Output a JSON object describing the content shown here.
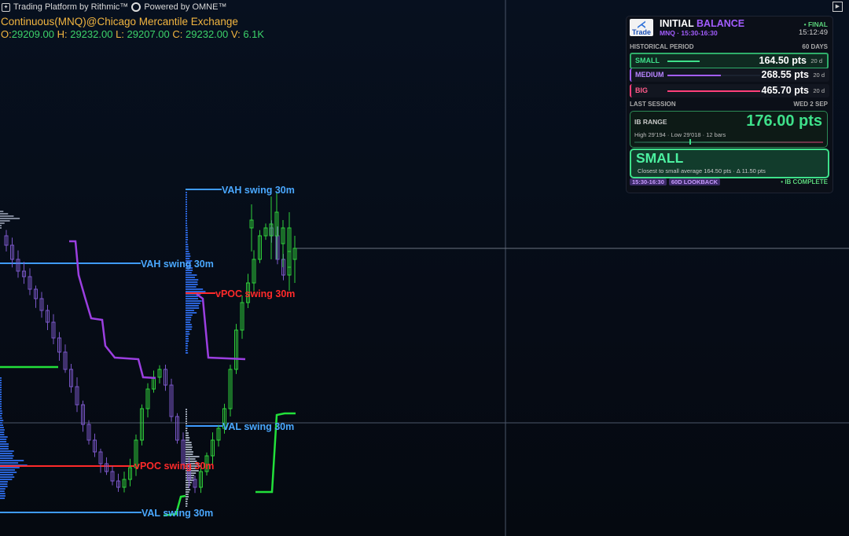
{
  "header": {
    "platform_text": "Trading Platform by Rithmic™",
    "powered_text": "Powered by OMNE™",
    "instrument": "Continuous(MNQ)@Chicago Mercantile Exchange",
    "ohlc": {
      "o_label": "O:",
      "o": "29209.00",
      "h_label": "H:",
      "h": "29232.00",
      "l_label": "L:",
      "l": "29207.00",
      "c_label": "C:",
      "c": "29232.00",
      "v_label": "V:",
      "v": "6.1K"
    }
  },
  "levels": {
    "vah_swing": "VAH swing 30m",
    "val_swing": "VAL swing 30m",
    "vpoc_swing": "vPOC swing 30m"
  },
  "colors": {
    "bull": "#2fcf3a",
    "bear": "#7a57c8",
    "level_blue": "#3f9bff",
    "level_red": "#ff2a2a",
    "trail_purple": "#9b3fe0",
    "trail_green": "#22e03a",
    "profile_blue": "#2a63d6"
  },
  "panel": {
    "logo_text": "Trade",
    "title_a": "INITIAL",
    "title_b": "BALANCE",
    "subtitle": "MNQ  ·  15:30-16:30",
    "status": "• FINAL",
    "time": "15:12:49",
    "historical_label": "HISTORICAL PERIOD",
    "historical_days": "60 DAYS",
    "rows": [
      {
        "label": "SMALL",
        "value": "164.50 pts",
        "days": "20 d",
        "color": "#3ee08a",
        "fill": 0.35
      },
      {
        "label": "MEDIUM",
        "value": "268.55 pts",
        "days": "20 d",
        "color": "#a35dff",
        "fill": 0.58
      },
      {
        "label": "BIG",
        "value": "465.70 pts",
        "days": "20 d",
        "color": "#ff3f7a",
        "fill": 1.0
      }
    ],
    "last_session_label": "LAST SESSION",
    "last_session_date": "WED 2 SEP",
    "ib_range_label": "IB RANGE",
    "ib_range_value": "176.00 pts",
    "ib_stats": "High 29'194   ·   Low 29'018   ·   12 bars",
    "classification": "SMALL",
    "classification_note": "Closest to small average 164.50 pts   ·   Δ 11.50 pts",
    "footer_tags": [
      "15:30-16:30",
      "60D LOOKBACK"
    ],
    "footer_status": "• IB COMPLETE"
  }
}
